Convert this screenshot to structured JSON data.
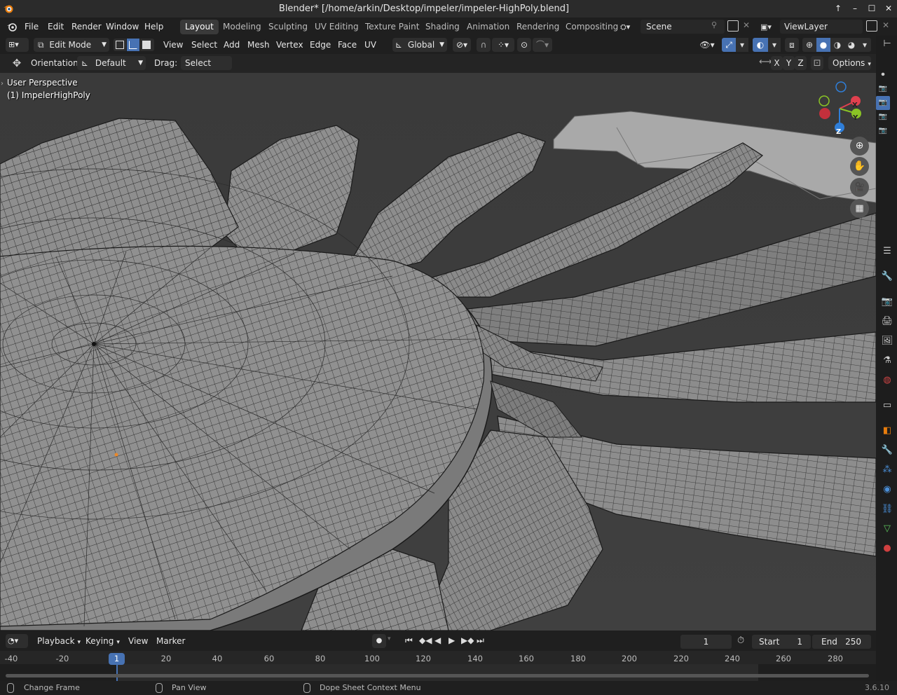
{
  "window": {
    "title": "Blender* [/home/arkin/Desktop/impeler/impeler-HighPoly.blend]",
    "controls": [
      "↑",
      "–",
      "☐",
      "✕"
    ]
  },
  "menu": [
    "File",
    "Edit",
    "Render",
    "Window",
    "Help"
  ],
  "workspaces": [
    "Layout",
    "Modeling",
    "Sculpting",
    "UV Editing",
    "Texture Paint",
    "Shading",
    "Animation",
    "Rendering",
    "Compositing"
  ],
  "active_workspace": "Layout",
  "scene": {
    "name": "Scene"
  },
  "view_layer": {
    "name": "ViewLayer"
  },
  "header": {
    "mode": "Edit Mode",
    "menus": [
      "View",
      "Select",
      "Add",
      "Mesh",
      "Vertex",
      "Edge",
      "Face",
      "UV"
    ],
    "transform_orientation": "Global"
  },
  "tool_header": {
    "orientation_label": "Orientation:",
    "orientation_value": "Default",
    "drag_label": "Drag:",
    "drag_value": "Select Box",
    "axes": [
      "X",
      "Y",
      "Z"
    ],
    "options": "Options"
  },
  "viewport": {
    "perspective": "User Perspective",
    "object": "(1) ImpelerHighPoly",
    "gizmo": {
      "x": "X",
      "y": "Y",
      "z": "Z"
    },
    "colors": {
      "background": "#3d3d3d",
      "mesh": "#8a8a8a",
      "wire": "#1a1a1a",
      "x_axis": "#e0404e",
      "y_axis": "#8ac425",
      "z_axis": "#2f7ed8"
    }
  },
  "timeline": {
    "menus": [
      "Playback",
      "Keying",
      "View",
      "Marker"
    ],
    "current_frame": "1",
    "start_label": "Start",
    "start_value": "1",
    "end_label": "End",
    "end_value": "250",
    "ticks": [
      "-40",
      "-20",
      "1",
      "20",
      "40",
      "60",
      "80",
      "100",
      "120",
      "140",
      "160",
      "180",
      "200",
      "220",
      "240",
      "260",
      "280"
    ]
  },
  "status": {
    "left": "Change Frame",
    "middle": "Pan View",
    "right": "Dope Sheet Context Menu",
    "version": "3.6.10"
  }
}
